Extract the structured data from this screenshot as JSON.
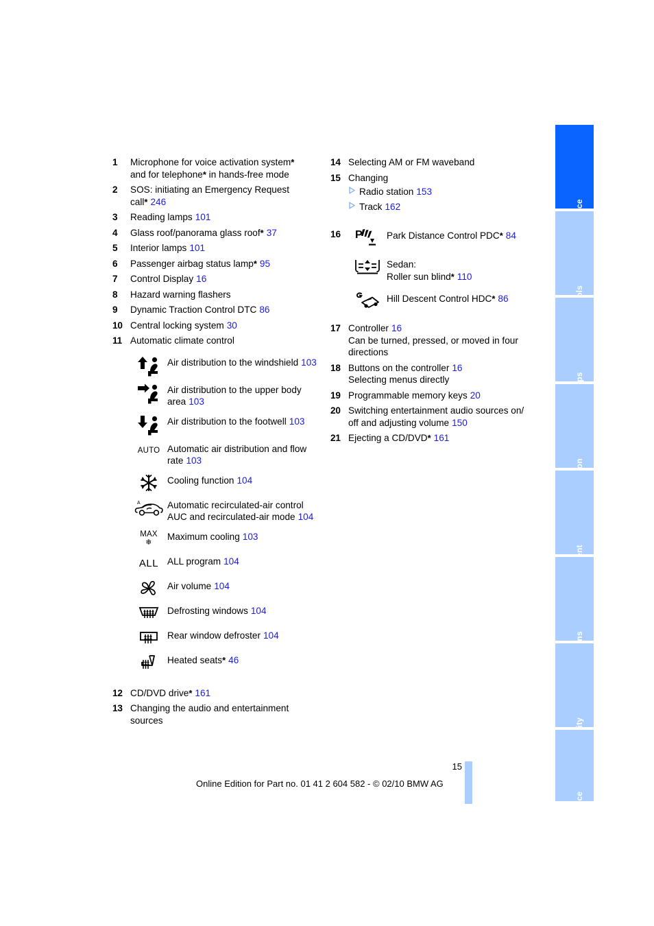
{
  "page": {
    "number": "15",
    "footer": "Online Edition for Part no. 01 41 2 604 582 - © 02/10 BMW AG",
    "accent_blue": "#1c1ce0",
    "tab_active_blue": "#0a64ff",
    "tab_inactive_blue": "#a9ceff"
  },
  "sidebar": {
    "tabs": [
      {
        "label": "At a glance",
        "active": true
      },
      {
        "label": "Controls",
        "active": false
      },
      {
        "label": "Driving tips",
        "active": false
      },
      {
        "label": "Navigation",
        "active": false
      },
      {
        "label": "Entertainment",
        "active": false
      },
      {
        "label": "Communications",
        "active": false
      },
      {
        "label": "Mobility",
        "active": false
      },
      {
        "label": "Reference",
        "active": false
      }
    ]
  },
  "left_column": {
    "entries": [
      {
        "num": "1",
        "text": "Microphone for voice activation system",
        "star": true,
        "text2": "and for telephone",
        "star2": true,
        "text2_tail": " in hands-free mode",
        "page": ""
      },
      {
        "num": "2",
        "text": "SOS: initiating an Emergency Request",
        "text2": "call",
        "star2": true,
        "page": "246"
      },
      {
        "num": "3",
        "text": "Reading lamps",
        "page": "101"
      },
      {
        "num": "4",
        "text": "Glass roof/panorama glass roof",
        "star": true,
        "page": "37"
      },
      {
        "num": "5",
        "text": "Interior lamps",
        "page": "101"
      },
      {
        "num": "6",
        "text": "Passenger airbag status lamp",
        "star": true,
        "page": "95"
      },
      {
        "num": "7",
        "text": "Control Display",
        "page": "16"
      },
      {
        "num": "8",
        "text": "Hazard warning flashers",
        "page": ""
      },
      {
        "num": "9",
        "text": "Dynamic Traction Control DTC",
        "page": "86"
      },
      {
        "num": "10",
        "text": "Central locking system",
        "page": "30"
      },
      {
        "num": "11",
        "text": "Automatic climate control",
        "page": ""
      }
    ],
    "climate_icons": [
      {
        "icon": "air-distribution-windshield-icon",
        "label": "Air distribution to the windshield",
        "page": "103"
      },
      {
        "icon": "air-distribution-upper-body-icon",
        "label": "Air distribution to the upper body area",
        "page": "103"
      },
      {
        "icon": "air-distribution-footwell-icon",
        "label": "Air distribution to the footwell",
        "page": "103"
      },
      {
        "icon": "auto-text-icon",
        "icon_text": "AUTO",
        "label": "Automatic air distribution and flow rate",
        "page": "103"
      },
      {
        "icon": "snowflake-cooling-icon",
        "label": "Cooling function",
        "page": "104"
      },
      {
        "icon": "recirculated-air-auc-icon",
        "label": "Automatic recirculated-air control AUC and recirculated-air mode",
        "page": "104"
      },
      {
        "icon": "max-cooling-icon",
        "icon_text": "MAX",
        "label": "Maximum cooling",
        "page": "103"
      },
      {
        "icon": "all-program-icon",
        "icon_text": "ALL",
        "label": "ALL program",
        "page": "104"
      },
      {
        "icon": "fan-air-volume-icon",
        "label": "Air volume",
        "page": "104"
      },
      {
        "icon": "defrosting-windows-icon",
        "label": "Defrosting windows",
        "page": "104"
      },
      {
        "icon": "rear-window-defroster-icon",
        "label": "Rear window defroster",
        "page": "104"
      },
      {
        "icon": "heated-seats-icon",
        "label": "Heated seats",
        "star": true,
        "page": "46"
      }
    ],
    "entries_tail": [
      {
        "num": "12",
        "text": "CD/DVD drive",
        "star": true,
        "page": "161"
      },
      {
        "num": "13",
        "text": "Changing the audio and entertainment sources",
        "page": ""
      }
    ]
  },
  "right_column": {
    "entries_head": [
      {
        "num": "14",
        "text": "Selecting AM or FM waveband",
        "page": ""
      },
      {
        "num": "15",
        "text": "Changing",
        "page": ""
      }
    ],
    "sub_items": [
      {
        "label": "Radio station",
        "page": "153"
      },
      {
        "label": "Track",
        "page": "162"
      }
    ],
    "item16": {
      "num": "16",
      "rows": [
        {
          "icon": "park-distance-control-icon",
          "label": "Park Distance Control PDC",
          "star": true,
          "page": "84"
        },
        {
          "icon": "roller-sun-blind-icon",
          "label_line1": "Sedan:",
          "label": "Roller sun blind",
          "star": true,
          "page": "110"
        },
        {
          "icon": "hill-descent-control-icon",
          "label": "Hill Descent Control HDC",
          "star": true,
          "page": "86"
        }
      ]
    },
    "entries_tail": [
      {
        "num": "17",
        "text": "Controller",
        "page": "16",
        "text2": "Can be turned, pressed, or moved in four directions"
      },
      {
        "num": "18",
        "text": "Buttons on the controller",
        "page": "16",
        "text2": "Selecting menus directly"
      },
      {
        "num": "19",
        "text": "Programmable memory keys",
        "page": "20"
      },
      {
        "num": "20",
        "text": "Switching entertainment audio sources on/ off and adjusting volume",
        "page": "150"
      },
      {
        "num": "21",
        "text": "Ejecting a CD/DVD",
        "star": true,
        "page": "161"
      }
    ]
  }
}
